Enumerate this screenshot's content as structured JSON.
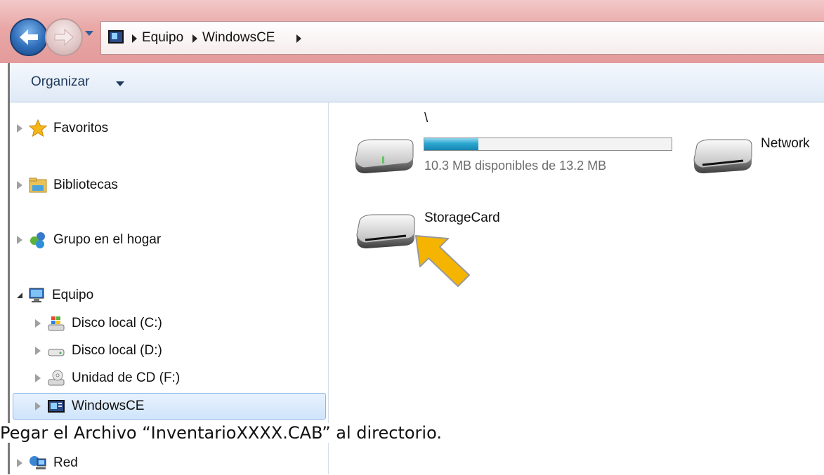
{
  "address": {
    "crumbs": [
      "Equipo",
      "WindowsCE"
    ]
  },
  "toolbar": {
    "organize_label": "Organizar"
  },
  "nav": {
    "favorites": "Favoritos",
    "libraries": "Bibliotecas",
    "homegroup": "Grupo en el hogar",
    "computer": "Equipo",
    "drive_c": "Disco local (C:)",
    "drive_d": "Disco local (D:)",
    "drive_f": "Unidad de CD (F:)",
    "windowsce": "WindowsCE",
    "network": "Red"
  },
  "content": {
    "root_drive": {
      "label": "\\",
      "capacity_text": "10.3 MB disponibles de 13.2 MB",
      "used_fraction": 0.22
    },
    "network_drive": {
      "label": "Network"
    },
    "storage_card": {
      "label": "StorageCard"
    }
  },
  "caption": "Pegar el Archivo “InventarioXXXX.CAB” al directorio.",
  "colors": {
    "title_gradient": "#e9a7a6",
    "arrow_fill": "#f4b400",
    "capacity_fill": "#2aa6cf",
    "selection": "#cfe4fb"
  }
}
